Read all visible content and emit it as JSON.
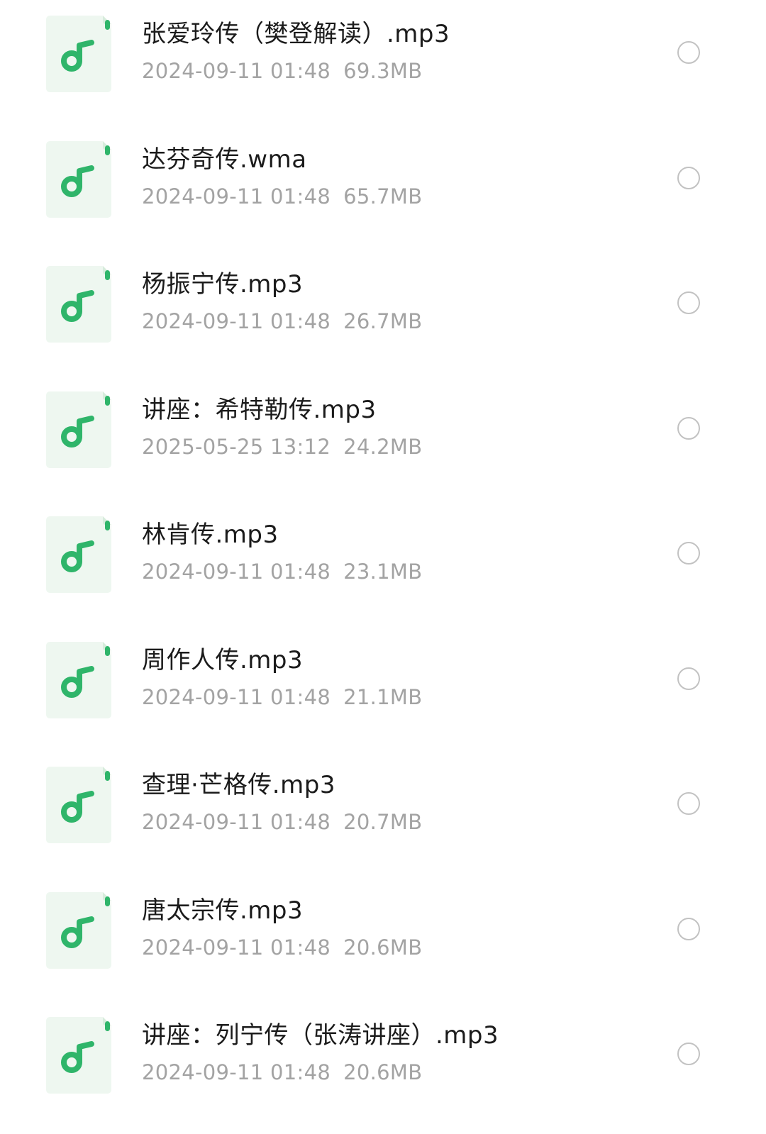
{
  "files": [
    {
      "name": "张爱玲传（樊登解读）.mp3",
      "date": "2024-09-11 01:48",
      "size": "69.3MB",
      "icon": "music-file-icon"
    },
    {
      "name": "达芬奇传.wma",
      "date": "2024-09-11 01:48",
      "size": "65.7MB",
      "icon": "music-file-icon"
    },
    {
      "name": "杨振宁传.mp3",
      "date": "2024-09-11 01:48",
      "size": "26.7MB",
      "icon": "music-file-icon"
    },
    {
      "name": "讲座：希特勒传.mp3",
      "date": "2025-05-25 13:12",
      "size": "24.2MB",
      "icon": "music-file-icon"
    },
    {
      "name": "林肯传.mp3",
      "date": "2024-09-11 01:48",
      "size": "23.1MB",
      "icon": "music-file-icon"
    },
    {
      "name": "周作人传.mp3",
      "date": "2024-09-11 01:48",
      "size": "21.1MB",
      "icon": "music-file-icon"
    },
    {
      "name": "查理·芒格传.mp3",
      "date": "2024-09-11 01:48",
      "size": "20.7MB",
      "icon": "music-file-icon"
    },
    {
      "name": "唐太宗传.mp3",
      "date": "2024-09-11 01:48",
      "size": "20.6MB",
      "icon": "music-file-icon"
    },
    {
      "name": "讲座：列宁传（张涛讲座）.mp3",
      "date": "2024-09-11 01:48",
      "size": "20.6MB",
      "icon": "music-file-icon"
    }
  ],
  "colors": {
    "accent": "#2fb56a",
    "icon_bg": "#eef7f0",
    "title_text": "#1b1b1b",
    "meta_text": "#a3a3a3",
    "radio_border": "#c2c2c2"
  }
}
